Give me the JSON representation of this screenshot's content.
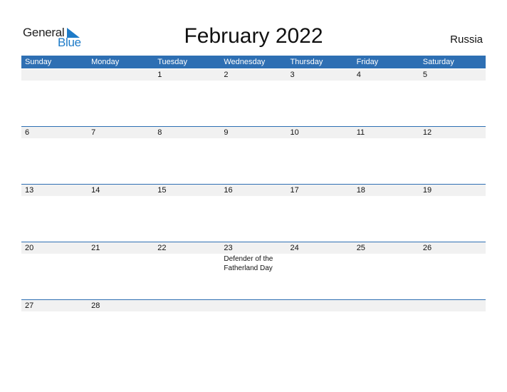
{
  "brand": {
    "part1": "General",
    "part2": "Blue"
  },
  "title": "February 2022",
  "country": "Russia",
  "weekdays": [
    "Sunday",
    "Monday",
    "Tuesday",
    "Wednesday",
    "Thursday",
    "Friday",
    "Saturday"
  ],
  "weeks": [
    [
      {
        "date": ""
      },
      {
        "date": ""
      },
      {
        "date": "1"
      },
      {
        "date": "2"
      },
      {
        "date": "3"
      },
      {
        "date": "4"
      },
      {
        "date": "5"
      }
    ],
    [
      {
        "date": "6"
      },
      {
        "date": "7"
      },
      {
        "date": "8"
      },
      {
        "date": "9"
      },
      {
        "date": "10"
      },
      {
        "date": "11"
      },
      {
        "date": "12"
      }
    ],
    [
      {
        "date": "13"
      },
      {
        "date": "14"
      },
      {
        "date": "15"
      },
      {
        "date": "16"
      },
      {
        "date": "17"
      },
      {
        "date": "18"
      },
      {
        "date": "19"
      }
    ],
    [
      {
        "date": "20"
      },
      {
        "date": "21"
      },
      {
        "date": "22"
      },
      {
        "date": "23",
        "event": "Defender of the Fatherland Day"
      },
      {
        "date": "24"
      },
      {
        "date": "25"
      },
      {
        "date": "26"
      }
    ],
    [
      {
        "date": "27"
      },
      {
        "date": "28"
      },
      {
        "date": ""
      },
      {
        "date": ""
      },
      {
        "date": ""
      },
      {
        "date": ""
      },
      {
        "date": ""
      }
    ]
  ],
  "colors": {
    "header": "#2e6fb3",
    "brand_blue": "#1e7bc8",
    "strip": "#f1f1f1"
  }
}
